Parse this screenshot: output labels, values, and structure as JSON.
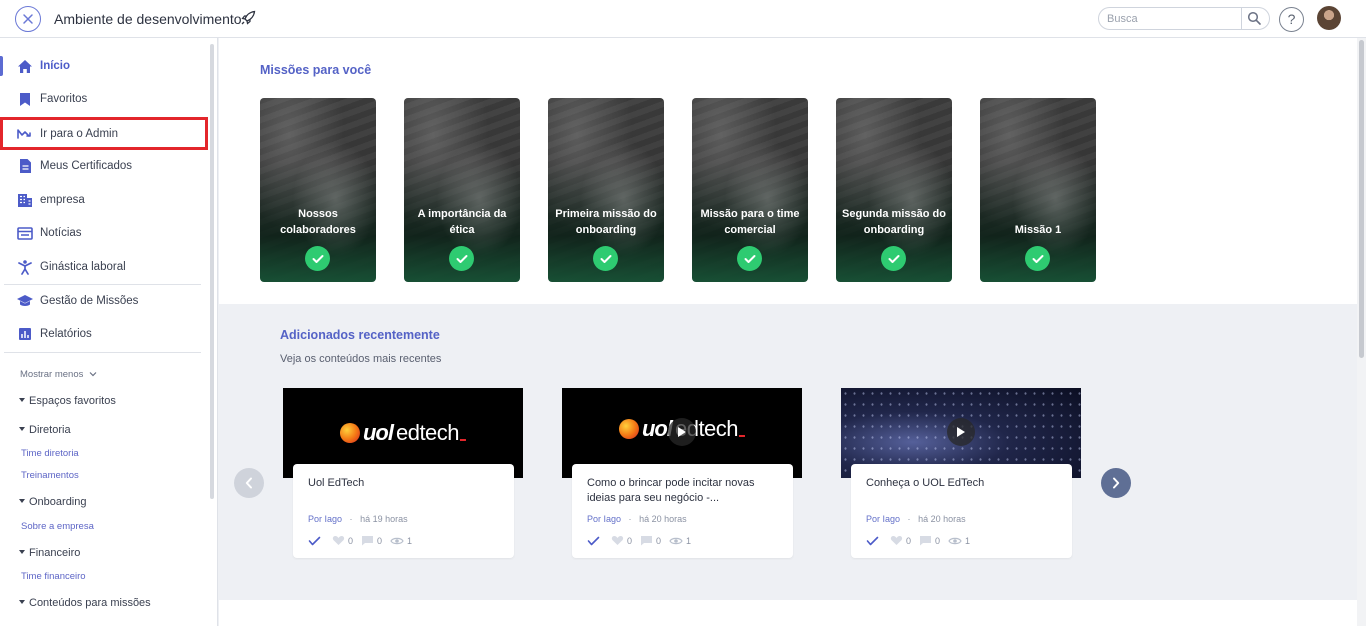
{
  "header": {
    "title": "Ambiente de desenvolvimento",
    "search_placeholder": "Busca",
    "help_label": "?"
  },
  "sidebar": {
    "items": [
      {
        "label": "Início",
        "icon": "home-icon"
      },
      {
        "label": "Favoritos",
        "icon": "bookmark-icon"
      },
      {
        "label": "Ir para o Admin",
        "icon": "admin-icon"
      },
      {
        "label": "Meus Certificados",
        "icon": "certificate-icon"
      },
      {
        "label": "empresa",
        "icon": "building-icon"
      },
      {
        "label": "Notícias",
        "icon": "news-icon"
      },
      {
        "label": "Ginástica laboral",
        "icon": "exercise-icon"
      },
      {
        "label": "Gestão de Missões",
        "icon": "graduation-cap-icon"
      },
      {
        "label": "Relatórios",
        "icon": "chart-icon"
      }
    ],
    "show_less": "Mostrar menos",
    "groups": [
      {
        "label": "Espaços favoritos"
      },
      {
        "label": "Diretoria",
        "links": [
          "Time diretoria",
          "Treinamentos"
        ]
      },
      {
        "label": "Onboarding",
        "links": [
          "Sobre a empresa"
        ]
      },
      {
        "label": "Financeiro",
        "links": [
          "Time financeiro"
        ]
      },
      {
        "label": "Conteúdos para missões"
      }
    ]
  },
  "missions": {
    "title": "Missões para você",
    "cards": [
      {
        "title": "Nossos colaboradores"
      },
      {
        "title": "A importância da ética"
      },
      {
        "title": "Primeira missão do onboarding"
      },
      {
        "title": "Missão para o time comercial"
      },
      {
        "title": "Segunda missão do onboarding"
      },
      {
        "title": "Missão 1"
      }
    ]
  },
  "recent": {
    "title": "Adicionados recentemente",
    "subtitle": "Veja os conteúdos mais recentes",
    "items": [
      {
        "title": "Uol EdTech",
        "author": "Por Iago",
        "time": "há 19 horas",
        "likes": "0",
        "comments": "0",
        "views": "1",
        "brand_uol": "uol",
        "brand_edtech": "edtech"
      },
      {
        "title": "Como o brincar pode incitar novas ideias para seu negócio -...",
        "author": "Por Iago",
        "time": "há 20 horas",
        "likes": "0",
        "comments": "0",
        "views": "1",
        "brand_uol": "uol",
        "brand_edtech": "edtech"
      },
      {
        "title": "Conheça o UOL EdTech",
        "author": "Por Iago",
        "time": "há 20 horas",
        "likes": "0",
        "comments": "0",
        "views": "1"
      }
    ]
  },
  "colors": {
    "accent": "#5462c6",
    "success": "#2ecb71",
    "highlight": "#e3262b"
  }
}
